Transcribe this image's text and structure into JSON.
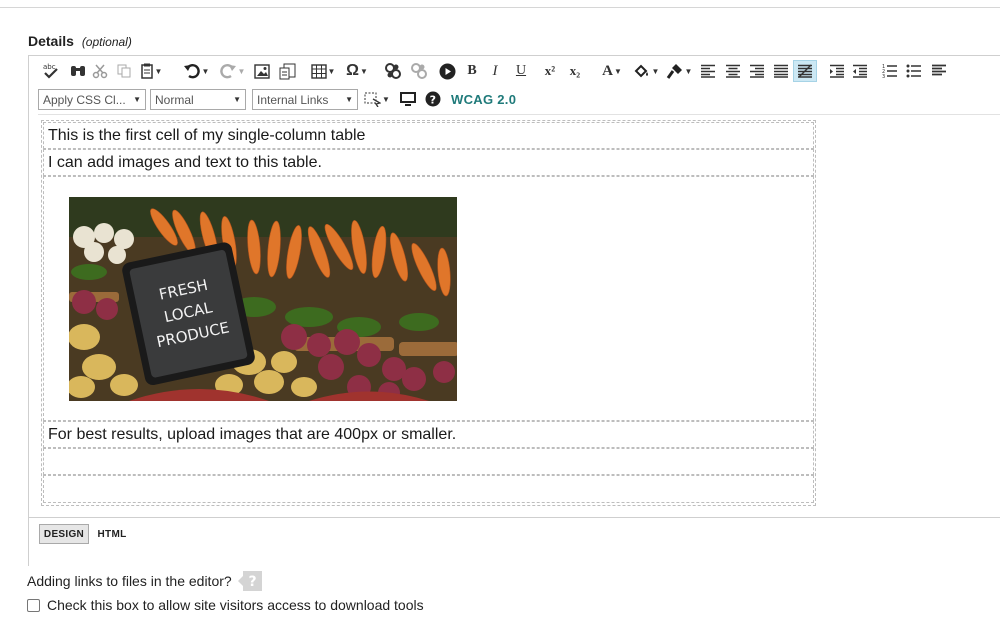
{
  "field": {
    "label": "Details",
    "qualifier": "(optional)"
  },
  "toolbar": {
    "css_class_select": "Apply CSS Cl...",
    "paragraph_format_select": "Normal",
    "internal_links_select": "Internal Links",
    "wcag_label": "WCAG 2.0",
    "superscript_label": "x²",
    "subscript_label": "x₂",
    "bold_label": "B",
    "italic_label": "I",
    "underline_label": "U",
    "fore_color_label": "A",
    "symbol_label": "Ω",
    "active_button": "justify-full"
  },
  "table": {
    "rows": [
      "This is the first cell of my single-column table",
      "I can add images and text to this table.",
      "",
      "For best results, upload images that are 400px or smaller.",
      "",
      ""
    ]
  },
  "image": {
    "chalkboard_line1": "FRESH",
    "chalkboard_line2": "LOCAL",
    "chalkboard_line3": "PRODUCE"
  },
  "modes": {
    "design": "DESIGN",
    "html": "HTML",
    "active": "DESIGN"
  },
  "help": {
    "links_text": "Adding links to files in the editor?",
    "icon_text": "?"
  },
  "download": {
    "label": "Check this box to allow site visitors access to download tools",
    "checked": false
  }
}
